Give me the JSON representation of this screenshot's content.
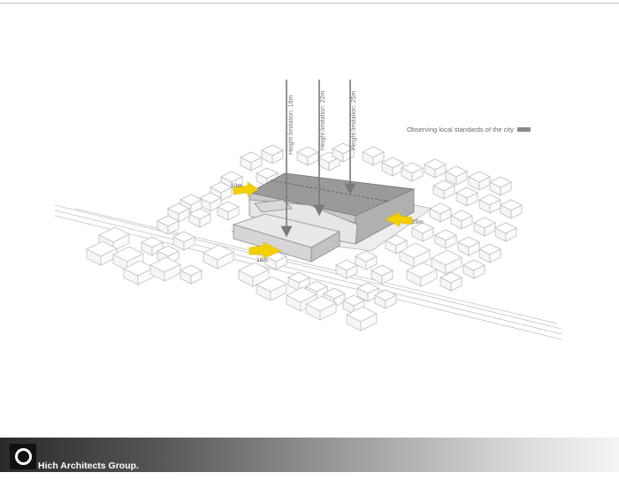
{
  "diagram": {
    "height_labels": [
      "Height limitation: 18m",
      "Height limitation: 22m",
      "Height limitation: 25m"
    ],
    "dimension_labels": {
      "west": "10m",
      "south": "18m",
      "east": "25m"
    }
  },
  "legend": {
    "label": "Observing local standards of the city"
  },
  "footer": {
    "company": "Hich Architects Group."
  },
  "colors": {
    "arrow_yellow": "#f5d000",
    "building_line": "#bdbdbd",
    "mass_dark": "#8f8f8f",
    "mass_light": "#e2e2e2"
  }
}
